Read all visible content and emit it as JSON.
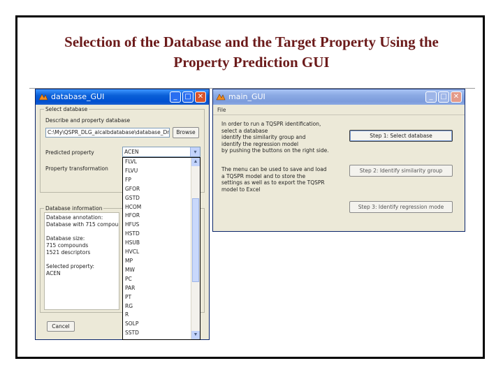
{
  "slide": {
    "title_line1": "Selection of the Database and the Target Property Using the",
    "title_line2": "Property Prediction GUI"
  },
  "colors": {
    "title": "#6b1a1a",
    "titlebar": "#0a5fd8",
    "window_bg": "#ece9d8"
  },
  "database_gui": {
    "window_title": "database_GUI",
    "controls": {
      "minimize": "_",
      "maximize": "□",
      "close": "✕"
    },
    "select_group_label": "Select database",
    "describe_label": "Describe and property database",
    "path_value": "C:\\My\\QSPR_DLG_alcalbdatabase\\database_Dra",
    "browse_label": "Browse",
    "predicted_property_label": "Predicted property",
    "predicted_property_value": "ACEN",
    "transformation_label": "Property transformation",
    "property_options": [
      "FLVL",
      "FLVU",
      "FP",
      "GFOR",
      "GSTD",
      "HCOM",
      "HFOR",
      "HFUS",
      "HSTD",
      "HSUB",
      "HVCL",
      "MP",
      "MW",
      "PC",
      "PAR",
      "PT",
      "RG",
      "R",
      "SOLP",
      "SSTD"
    ],
    "info_group_label": "Database information",
    "info_lines": [
      "Database annotation:",
      "Database with 715 compounds",
      "",
      "Database size:",
      "715 compounds",
      "1521 descriptors",
      "",
      "Selected property:",
      "ACEN"
    ],
    "cancel_label": "Cancel"
  },
  "main_gui": {
    "window_title": "main_GUI",
    "menu_file": "File",
    "instructions_1": [
      "In order to run a TQSPR identification,",
      "select a database",
      "identify the similarity group and",
      "identify the regression model",
      "by pushing the buttons on the right side."
    ],
    "instructions_2": [
      "The menu can be used to save and load",
      "a TQSPR model and to store the",
      "settings as well as to export the TQSPR",
      "model to Excel"
    ],
    "step1_label": "Step 1: Select database",
    "step2_label": "Step 2: Identify similarity group",
    "step3_label": "Step 3: Identify regression mode"
  }
}
